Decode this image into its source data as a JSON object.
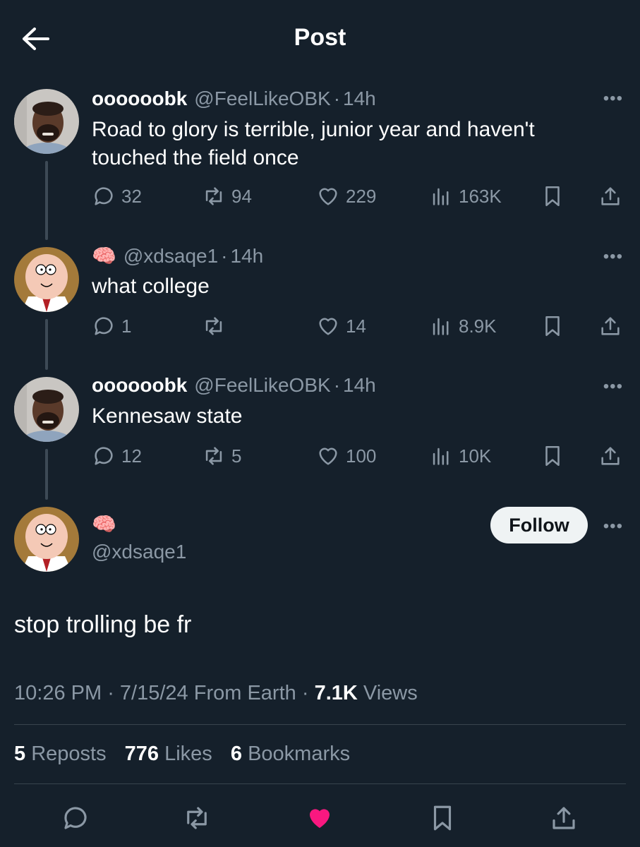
{
  "header": {
    "title": "Post",
    "back_icon": "arrow-left-icon"
  },
  "thread": [
    {
      "display_name": "oooooobk",
      "handle": "@FeelLikeOBK",
      "sep": "·",
      "time": "14h",
      "text": "Road to glory is terrible, junior year and haven't touched the field once",
      "replies": "32",
      "reposts": "94",
      "likes": "229",
      "views": "163K"
    },
    {
      "display_name": "🧠",
      "handle": "@xdsaqe1",
      "sep": "·",
      "time": "14h",
      "text": "what college",
      "replies": "1",
      "reposts": "",
      "likes": "14",
      "views": "8.9K"
    },
    {
      "display_name": "oooooobk",
      "handle": "@FeelLikeOBK",
      "sep": "·",
      "time": "14h",
      "text": "Kennesaw state",
      "replies": "12",
      "reposts": "5",
      "likes": "100",
      "views": "10K"
    }
  ],
  "main_post": {
    "display_name": "🧠",
    "handle": "@xdsaqe1",
    "follow_label": "Follow",
    "text": "stop trolling be fr",
    "time": "10:26 PM",
    "date": "7/15/24",
    "source": "From Earth",
    "views_count": "7.1K",
    "views_label": "Views",
    "stats": {
      "reposts_count": "5",
      "reposts_label": "Reposts",
      "likes_count": "776",
      "likes_label": "Likes",
      "bookmarks_count": "6",
      "bookmarks_label": "Bookmarks"
    }
  },
  "more_label": "•••",
  "colors": {
    "background": "#15202b",
    "text_secondary": "#8b98a5",
    "like_active": "#f91880",
    "divider": "#38444d"
  }
}
